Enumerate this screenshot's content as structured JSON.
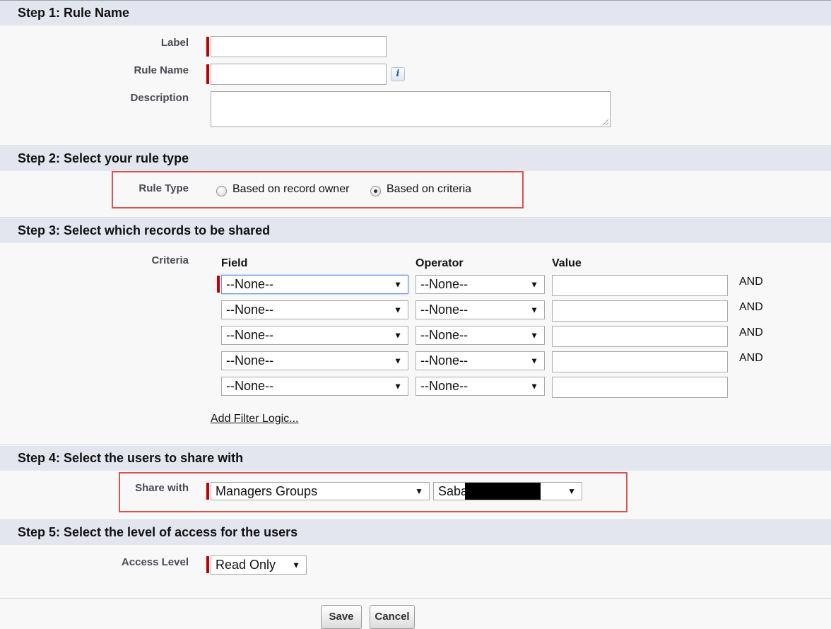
{
  "step1": {
    "header": "Step 1: Rule Name",
    "label_label": "Label",
    "label_value": "",
    "rule_name_label": "Rule Name",
    "rule_name_value": "",
    "info_glyph": "i",
    "description_label": "Description",
    "description_value": ""
  },
  "step2": {
    "header": "Step 2: Select your rule type",
    "rule_type_label": "Rule Type",
    "option_owner": "Based on record owner",
    "option_criteria": "Based on criteria",
    "selected": "Based on criteria"
  },
  "step3": {
    "header": "Step 3: Select which records to be shared",
    "criteria_label": "Criteria",
    "col_field": "Field",
    "col_operator": "Operator",
    "col_value": "Value",
    "rows": [
      {
        "field": "--None--",
        "operator": "--None--",
        "value": "",
        "join": "AND"
      },
      {
        "field": "--None--",
        "operator": "--None--",
        "value": "",
        "join": "AND"
      },
      {
        "field": "--None--",
        "operator": "--None--",
        "value": "",
        "join": "AND"
      },
      {
        "field": "--None--",
        "operator": "--None--",
        "value": "",
        "join": "AND"
      },
      {
        "field": "--None--",
        "operator": "--None--",
        "value": "",
        "join": ""
      }
    ],
    "add_filter_logic": "Add Filter Logic..."
  },
  "step4": {
    "header": "Step 4: Select the users to share with",
    "share_with_label": "Share with",
    "share_type": "Managers Groups",
    "share_target": "Saba"
  },
  "step5": {
    "header": "Step 5: Select the level of access for the users",
    "access_level_label": "Access Level",
    "access_level": "Read Only"
  },
  "buttons": {
    "save": "Save",
    "cancel": "Cancel"
  },
  "icons": {
    "dropdown_arrow": "▼"
  },
  "colors": {
    "section_header_bg": "#e3e6ef",
    "required_marker": "#c00000",
    "highlight_box": "#d9534f"
  }
}
